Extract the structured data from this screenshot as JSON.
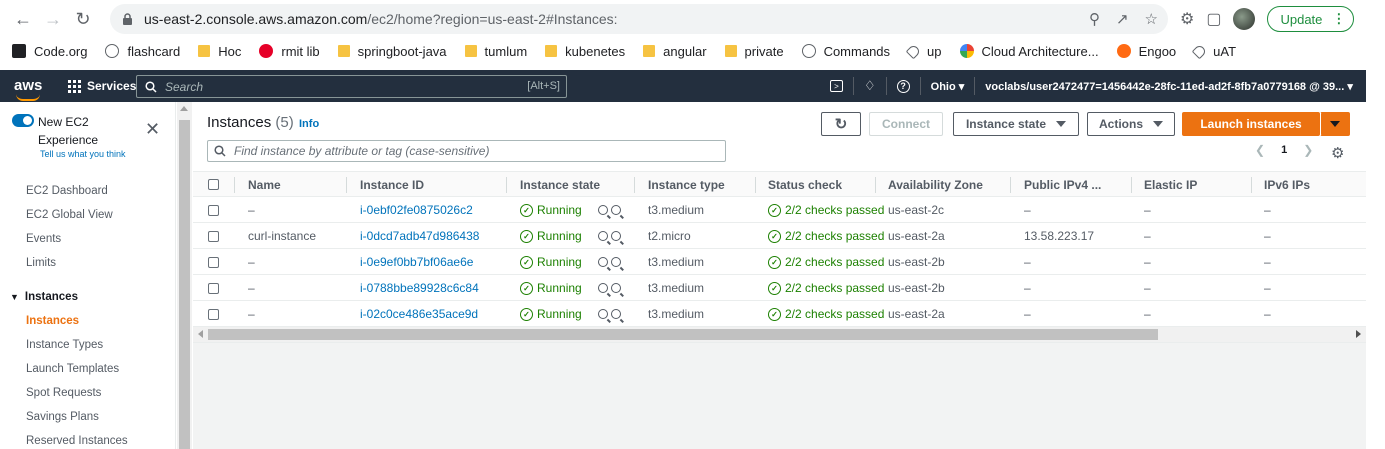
{
  "browser": {
    "url_host": "us-east-2.console.aws.amazon.com",
    "url_rest": "/ec2/home?region=us-east-2#Instances:",
    "update_label": "Update"
  },
  "bookmarks": [
    {
      "label": "Code.org",
      "icon": "codeorg-icon"
    },
    {
      "label": "flashcard",
      "icon": "globe-icon"
    },
    {
      "label": "Hoc",
      "icon": "folder-icon"
    },
    {
      "label": "rmit lib",
      "icon": "rmit-icon"
    },
    {
      "label": "springboot-java",
      "icon": "folder-icon"
    },
    {
      "label": "tumlum",
      "icon": "folder-icon"
    },
    {
      "label": "kubenetes",
      "icon": "folder-icon"
    },
    {
      "label": "angular",
      "icon": "folder-icon"
    },
    {
      "label": "private",
      "icon": "folder-icon"
    },
    {
      "label": "Commands",
      "icon": "globe-icon"
    },
    {
      "label": "up",
      "icon": "tag-icon"
    },
    {
      "label": "Cloud Architecture...",
      "icon": "gcp-icon"
    },
    {
      "label": "Engoo",
      "icon": "engoo-icon"
    },
    {
      "label": "uAT",
      "icon": "tag-icon"
    }
  ],
  "aws": {
    "logo": "aws",
    "services": "Services",
    "search_placeholder": "Search",
    "search_shortcut": "[Alt+S]",
    "region": "Ohio",
    "account": "voclabs/user2472477=1456442e-28fc-11ed-ad2f-8fb7a0779168 @ 39..."
  },
  "sidebar": {
    "new_exp_line1": "New EC2",
    "new_exp_line2": "Experience",
    "tell_us": "Tell us what you think",
    "links": [
      "EC2 Dashboard",
      "EC2 Global View",
      "Events",
      "Limits"
    ],
    "section": "Instances",
    "section_items": [
      "Instances",
      "Instance Types",
      "Launch Templates",
      "Spot Requests",
      "Savings Plans",
      "Reserved Instances"
    ]
  },
  "main": {
    "title": "Instances",
    "count": "(5)",
    "info": "Info",
    "connect": "Connect",
    "instance_state": "Instance state",
    "actions": "Actions",
    "launch": "Launch instances",
    "find_placeholder": "Find instance by attribute or tag (case-sensitive)",
    "page": "1",
    "columns": [
      "Name",
      "Instance ID",
      "Instance state",
      "Instance type",
      "Status check",
      "Availability Zone",
      "Public IPv4 ...",
      "Elastic IP",
      "IPv6 IPs"
    ],
    "rows": [
      {
        "name": "–",
        "id": "i-0ebf02fe0875026c2",
        "state": "Running",
        "type": "t3.medium",
        "status": "2/2 checks passed",
        "az": "us-east-2c",
        "ipv4": "–",
        "eip": "–",
        "ipv6": "–"
      },
      {
        "name": "curl-instance",
        "id": "i-0dcd7adb47d986438",
        "state": "Running",
        "type": "t2.micro",
        "status": "2/2 checks passed",
        "az": "us-east-2a",
        "ipv4": "13.58.223.17",
        "eip": "–",
        "ipv6": "–"
      },
      {
        "name": "–",
        "id": "i-0e9ef0bb7bf06ae6e",
        "state": "Running",
        "type": "t3.medium",
        "status": "2/2 checks passed",
        "az": "us-east-2b",
        "ipv4": "–",
        "eip": "–",
        "ipv6": "–"
      },
      {
        "name": "–",
        "id": "i-0788bbe89928c6c84",
        "state": "Running",
        "type": "t3.medium",
        "status": "2/2 checks passed",
        "az": "us-east-2b",
        "ipv4": "–",
        "eip": "–",
        "ipv6": "–"
      },
      {
        "name": "–",
        "id": "i-02c0ce486e35ace9d",
        "state": "Running",
        "type": "t3.medium",
        "status": "2/2 checks passed",
        "az": "us-east-2a",
        "ipv4": "–",
        "eip": "–",
        "ipv6": "–"
      }
    ]
  },
  "colors": {
    "aws_nav": "#232f3e",
    "accent": "#ec7211",
    "link": "#0073bb",
    "success": "#1d8102"
  }
}
